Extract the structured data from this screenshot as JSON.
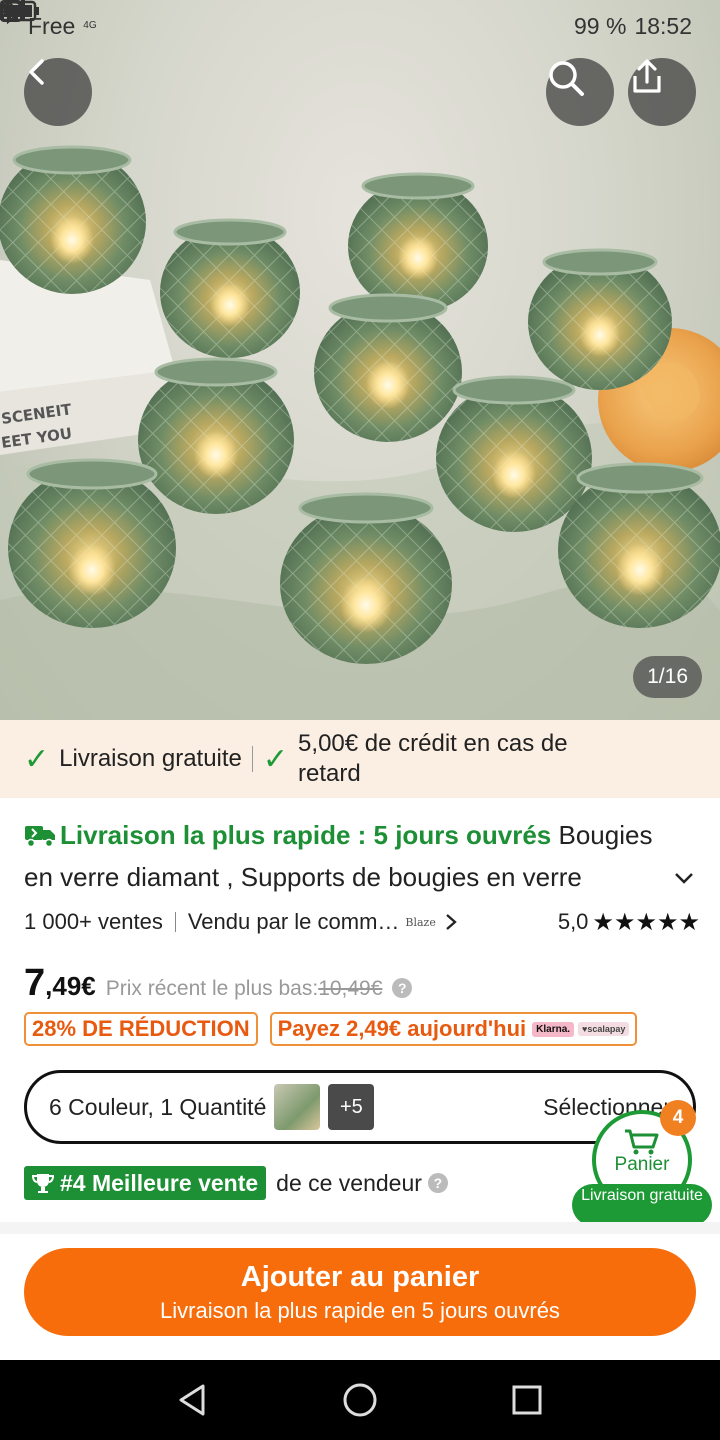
{
  "status_bar": {
    "carrier": "Free",
    "network": "4G",
    "battery": "99 %",
    "time": "18:52"
  },
  "gallery": {
    "counter": "1/16",
    "box_text_1": "SCENEIT",
    "box_text_2": "EET YOU"
  },
  "delivery_banner": {
    "free_shipping": "Livraison gratuite",
    "credit": "5,00€ de crédit en cas de retard"
  },
  "product": {
    "fast_delivery": "Livraison la plus rapide : 5 jours ouvrés",
    "title": " Bougies en verre diamant , Supports de bougies en verre",
    "sales": "1 000+ ventes",
    "seller": "Vendu par le comm…",
    "seller_logo": "Blaze",
    "rating": "5,0",
    "stars": "★★★★★",
    "price_int": "7",
    "price_dec": ",49€",
    "recent_low_label": "Prix récent le plus bas:",
    "old_price": "10,49€",
    "discount": "28% DE RÉDUCTION",
    "pay_today": "Payez 2,49€ aujourd'hui",
    "klarna": "Klarna.",
    "scalapay": "♥scalapay"
  },
  "variant": {
    "label": "6 Couleur, 1 Quantité",
    "more": "+5",
    "select": "Sélectionner"
  },
  "best_seller": {
    "tag": "#4 Meilleure vente",
    "text": "de ce vendeur"
  },
  "cart": {
    "count": "4",
    "label": "Panier",
    "free": "Livraison gratuite"
  },
  "cta": {
    "label": "Ajouter au panier",
    "sub": "Livraison la plus rapide en 5 jours ouvrés"
  },
  "colors": {
    "green": "#1d8f35",
    "orange": "#f76d0b",
    "banner_bg": "#fbeee2"
  }
}
